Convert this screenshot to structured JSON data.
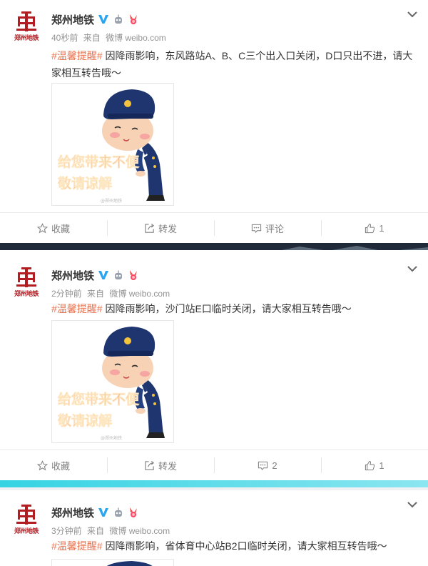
{
  "account": {
    "name": "郑州地铁",
    "logo_text": "郑州地铁"
  },
  "posts": [
    {
      "time": "40秒前",
      "source_prefix": "来自",
      "source": "微博 weibo.com",
      "topic": "#温馨提醒#",
      "text": " 因降雨影响，东风路站A、B、C三个出入口关闭，D口只出不进，请大家相互转告哦～",
      "image_caption": [
        "给您带来不便",
        "敬请谅解"
      ],
      "image_watermark": "@郑州地铁",
      "actions": {
        "favorite": "收藏",
        "repost": "转发",
        "comment": "评论",
        "like": "1"
      }
    },
    {
      "time": "2分钟前",
      "source_prefix": "来自",
      "source": "微博 weibo.com",
      "topic": "#温馨提醒#",
      "text": " 因降雨影响，沙门站E口临时关闭，请大家相互转告哦～",
      "image_caption": [
        "给您带来不便",
        "敬请谅解"
      ],
      "image_watermark": "@郑州地铁",
      "actions": {
        "favorite": "收藏",
        "repost": "转发",
        "comment": "2",
        "like": "1"
      }
    },
    {
      "time": "3分钟前",
      "source_prefix": "来自",
      "source": "微博 weibo.com",
      "topic": "#温馨提醒#",
      "text": " 因降雨影响，省体育中心站B2口临时关闭，请大家相互转告哦～"
    }
  ],
  "colors": {
    "topic": "#eb7350",
    "verified": "#2aa5f0",
    "logo": "#b21d22",
    "caption": "#e8502a"
  },
  "icons": [
    "chevron-down-icon",
    "verified-v-icon",
    "robot-icon",
    "medal-icon",
    "star-icon",
    "share-icon",
    "comment-icon",
    "like-icon"
  ]
}
